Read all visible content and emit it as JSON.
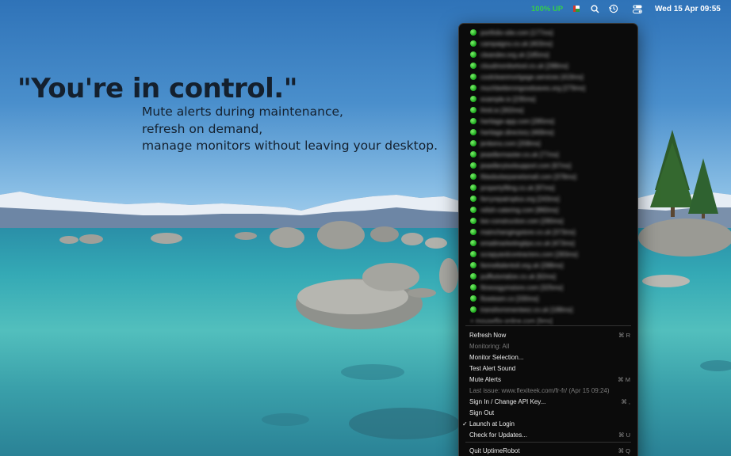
{
  "menubar": {
    "status": "100% UP",
    "clock": "Wed 15 Apr  09:55",
    "icons": [
      "uptimerobot-flag-icon",
      "search-icon",
      "history-icon",
      "control-center-icon"
    ]
  },
  "headline": "\"You're in control.\"",
  "subtext": [
    "Mute alerts during maintenance,",
    "refresh on demand,",
    "manage monitors without leaving your desktop."
  ],
  "menu": {
    "monitors": [
      {
        "status": "up",
        "color": "#2ecc40",
        "label": "portfolio-site.com [177ms]"
      },
      {
        "status": "up",
        "color": "#2ecc40",
        "label": "campaigns.co.uk [403ms]"
      },
      {
        "status": "up",
        "color": "#2ecc40",
        "label": "cleandev.org.uk [185ms]"
      },
      {
        "status": "up",
        "color": "#2ecc40",
        "label": "cloudmonitortool.co.uk [288ms]"
      },
      {
        "status": "up",
        "color": "#2ecc40",
        "label": "coolcleanmortgage.services [419ms]"
      },
      {
        "status": "up",
        "color": "#2ecc40",
        "label": "muchbetterongoodsaves.org [279ms]"
      },
      {
        "status": "up",
        "color": "#2ecc40",
        "label": "example.io [235ms]"
      },
      {
        "status": "up",
        "color": "#2ecc40",
        "label": "frinit.io [302ms]"
      },
      {
        "status": "up",
        "color": "#2ecc40",
        "label": "heritage-app.com [285ms]"
      },
      {
        "status": "up",
        "color": "#2ecc40",
        "label": "heritage.directory [469ms]"
      },
      {
        "status": "up",
        "color": "#2ecc40",
        "label": "jenkens.com [208ms]"
      },
      {
        "status": "up",
        "color": "#2ecc40",
        "label": "jewellermaster.co.uk [77ms]"
      },
      {
        "status": "up",
        "color": "#2ecc40",
        "label": "jewellerytoolsupport.com [67ms]"
      },
      {
        "status": "up",
        "color": "#2ecc40",
        "label": "fittedsolarpanelsmall.com [378ms]"
      },
      {
        "status": "up",
        "color": "#2ecc40",
        "label": "propertyfiling.co.uk [97ms]"
      },
      {
        "status": "up",
        "color": "#2ecc40",
        "label": "ferryrepairsplus.org [243ms]"
      },
      {
        "status": "up",
        "color": "#2ecc40",
        "label": "relish-catering.com [860ms]"
      },
      {
        "status": "up",
        "color": "#2ecc40",
        "label": "lee-construction.com [280ms]"
      },
      {
        "status": "up",
        "color": "#2ecc40",
        "label": "mainchangingstore.co.uk [373ms]"
      },
      {
        "status": "up",
        "color": "#2ecc40",
        "label": "emailmarketingtips.co.uk [473ms]"
      },
      {
        "status": "up",
        "color": "#2ecc40",
        "label": "scrapyardcontractors.com [283ms]"
      },
      {
        "status": "up",
        "color": "#2ecc40",
        "label": "fenneltalentoil.org.uk [288ms]"
      },
      {
        "status": "up",
        "color": "#2ecc40",
        "label": "pufftutorialize.co.uk [62ms]"
      },
      {
        "status": "up",
        "color": "#2ecc40",
        "label": "fitnessgymstore.com [325ms]"
      },
      {
        "status": "up",
        "color": "#2ecc40",
        "label": "flowteam.co [330ms]"
      },
      {
        "status": "up",
        "color": "#2ecc40",
        "label": "transformmenteez.co.uk [188ms]"
      }
    ],
    "more_label": "+ mouseflix-online.com [6ms]",
    "actions": [
      {
        "label": "Refresh Now",
        "shortcut": "⌘ R",
        "enabled": true,
        "checked": false
      },
      {
        "label": "Monitoring: All",
        "shortcut": "",
        "enabled": false,
        "checked": false
      },
      {
        "label": "Monitor Selection...",
        "shortcut": "",
        "enabled": true,
        "checked": false
      },
      {
        "label": "Test Alert Sound",
        "shortcut": "",
        "enabled": true,
        "checked": false
      },
      {
        "label": "Mute Alerts",
        "shortcut": "⌘ M",
        "enabled": true,
        "checked": false
      },
      {
        "label": "Last issue: www.flexiteek.com/fr-fr/ (Apr 15 09:24)",
        "shortcut": "",
        "enabled": false,
        "checked": false
      },
      {
        "label": "Sign In / Change API Key...",
        "shortcut": "⌘ ,",
        "enabled": true,
        "checked": false
      },
      {
        "label": "Sign Out",
        "shortcut": "",
        "enabled": true,
        "checked": false
      },
      {
        "label": "Launch at Login",
        "shortcut": "",
        "enabled": true,
        "checked": true
      },
      {
        "label": "Check for Updates...",
        "shortcut": "⌘ U",
        "enabled": true,
        "checked": false
      },
      {
        "label": "Quit UptimeRobot",
        "shortcut": "⌘ Q",
        "enabled": true,
        "checked": false
      }
    ]
  }
}
